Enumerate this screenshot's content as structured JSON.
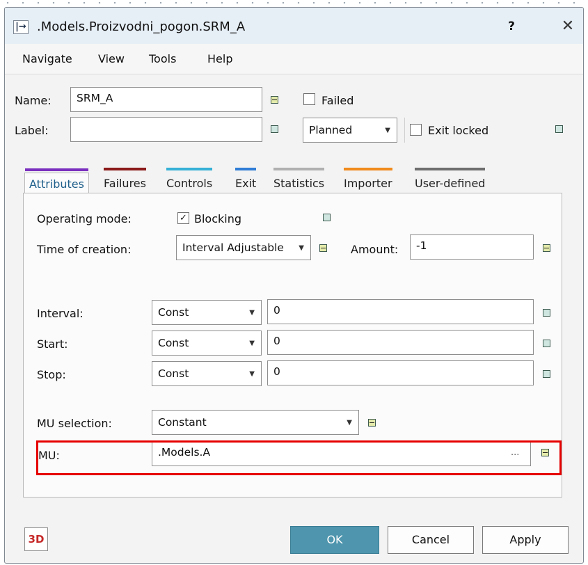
{
  "window": {
    "title": ".Models.Proizvodni_pogon.SRM_A",
    "title_icon_glyph": "|→",
    "help_glyph": "?",
    "close_glyph": "✕"
  },
  "menu": [
    "Navigate",
    "View",
    "Tools",
    "Help"
  ],
  "header": {
    "name_label": "Name:",
    "name_value": "SRM_A",
    "failed_label": "Failed",
    "label_label": "Label:",
    "label_value": "",
    "state_value": "Planned",
    "exit_locked_label": "Exit locked"
  },
  "tabs": [
    {
      "label": "Attributes",
      "stripe": "#7b2fbe",
      "active": true
    },
    {
      "label": "Failures",
      "stripe": "#8b1a1a"
    },
    {
      "label": "Controls",
      "stripe": "#36b0d6"
    },
    {
      "label": "Exit",
      "stripe": "#2f7dd6"
    },
    {
      "label": "Statistics",
      "stripe": "#b0b0b0"
    },
    {
      "label": "Importer",
      "stripe": "#f08a1c"
    },
    {
      "label": "User-defined",
      "stripe": "#6e6e6e"
    }
  ],
  "attributes": {
    "operating_mode_label": "Operating mode:",
    "blocking_label": "Blocking",
    "blocking_checked": true,
    "time_of_creation_label": "Time of creation:",
    "time_of_creation_value": "Interval Adjustable",
    "amount_label": "Amount:",
    "amount_value": "-1",
    "interval_label": "Interval:",
    "interval_type": "Const",
    "interval_value": "0",
    "start_label": "Start:",
    "start_type": "Const",
    "start_value": "0",
    "stop_label": "Stop:",
    "stop_type": "Const",
    "stop_value": "0",
    "mu_selection_label": "MU selection:",
    "mu_selection_value": "Constant",
    "mu_label": "MU:",
    "mu_value": ".Models.A",
    "mu_browse": "..."
  },
  "footer": {
    "btn_3d": "3D",
    "ok": "OK",
    "cancel": "Cancel",
    "apply": "Apply"
  },
  "colors": {
    "accent": "#4e95ad",
    "highlight": "#e60000",
    "active_tab_text": "#1f5f8b"
  }
}
